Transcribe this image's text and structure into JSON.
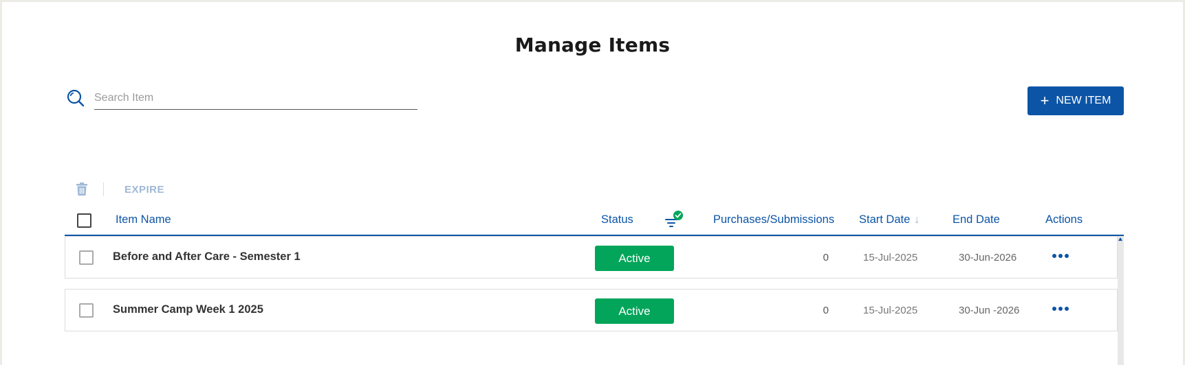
{
  "page": {
    "title": "Manage Items"
  },
  "search": {
    "placeholder": "Search Item",
    "value": ""
  },
  "toolbar": {
    "new_item_label": "NEW ITEM",
    "expire_label": "EXPIRE"
  },
  "table": {
    "headers": {
      "item_name": "Item Name",
      "status": "Status",
      "purchases": "Purchases/Submissions",
      "start_date": "Start Date",
      "end_date": "End Date",
      "actions": "Actions"
    },
    "sort": {
      "column": "start_date",
      "direction": "descending"
    },
    "status_filter_active": true,
    "rows": [
      {
        "name": "Before and After Care - Semester 1",
        "status": "Active",
        "purchases": "0",
        "start_date": "15-Jul-2025",
        "end_date": "30-Jun-2026"
      },
      {
        "name": "Summer Camp Week 1 2025",
        "status": "Active",
        "purchases": "0",
        "start_date": "15-Jul-2025",
        "end_date": "30-Jun -2026"
      }
    ]
  },
  "colors": {
    "primary": "#0c54a6",
    "active_status": "#03a55a",
    "filter_badge": "#03a55a",
    "disabled_action": "#9fb8d6"
  },
  "icons": {
    "search": "search-icon",
    "trash": "trash-icon",
    "filter": "filter-icon",
    "sort": "arrow-down-icon",
    "more": "more-horizontal-icon",
    "plus": "plus-icon"
  }
}
